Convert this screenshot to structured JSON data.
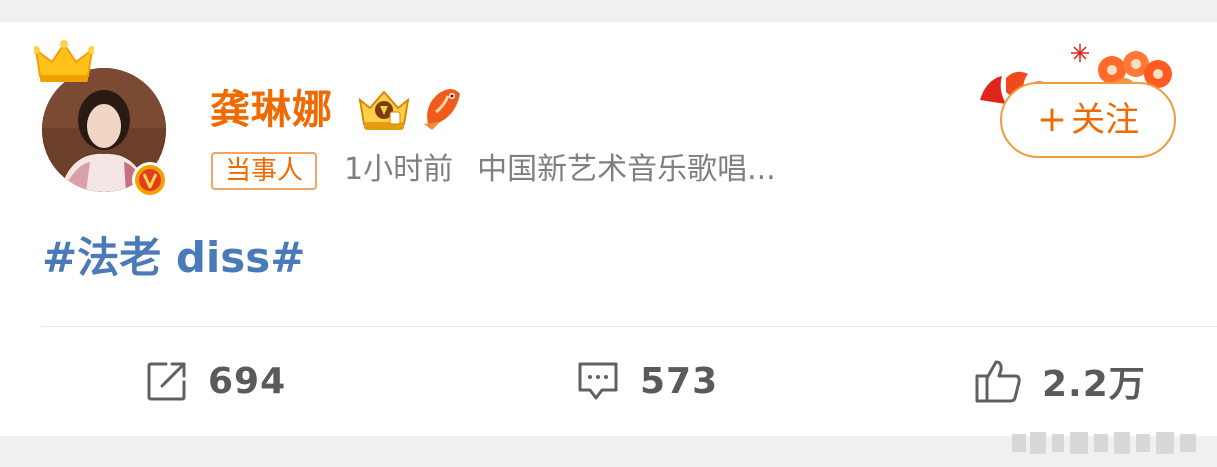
{
  "post": {
    "author": {
      "name": "龚琳娜",
      "tag": "当事人"
    },
    "meta": {
      "time": "1小时前",
      "source": "中国新艺术音乐歌唱..."
    },
    "follow": {
      "plus": "+",
      "label": "关注"
    },
    "content": {
      "hashtag": "#法老 diss#"
    },
    "actions": {
      "forward": "694",
      "comment": "573",
      "like": "2.2万"
    }
  },
  "colors": {
    "accent": "#f06a00",
    "link": "#4a7ab8",
    "meta": "#808080",
    "verified": "#f5a000"
  },
  "icons": [
    "crown-icon",
    "verified-icon",
    "vip-badge-icon",
    "fish-badge-icon",
    "forward-icon",
    "comment-icon",
    "like-icon"
  ]
}
